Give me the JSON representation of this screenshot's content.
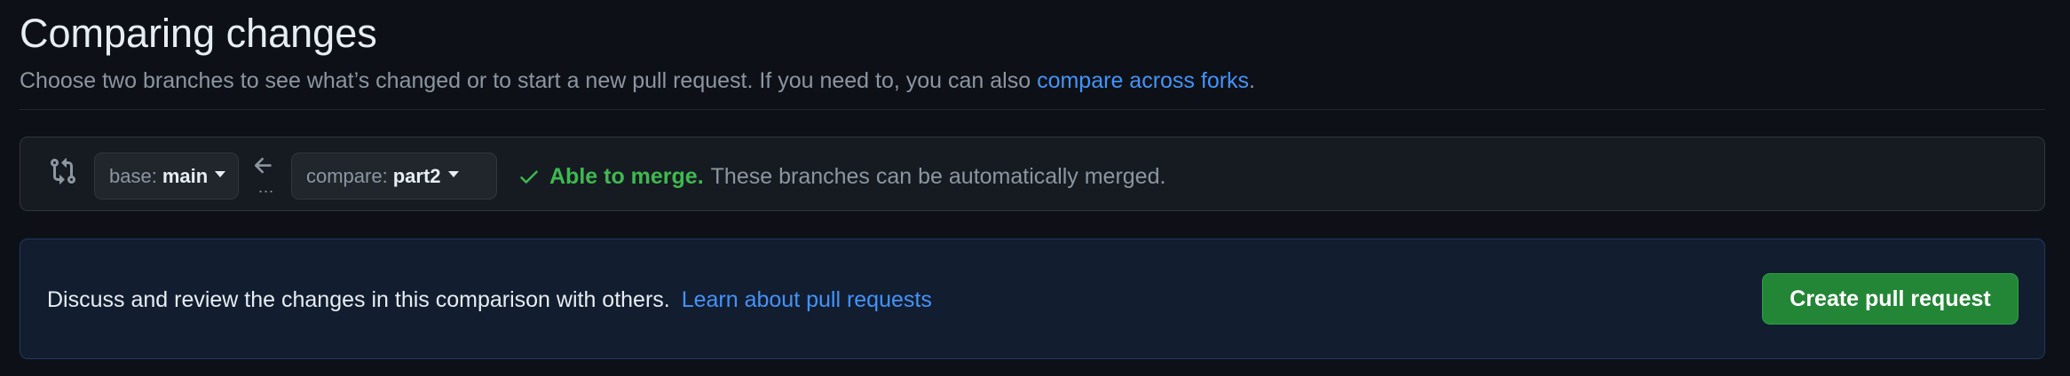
{
  "header": {
    "title": "Comparing changes",
    "subtitle_text": "Choose two branches to see what’s changed or to start a new pull request. If you need to, you can also",
    "subtitle_link": "compare across forks",
    "subtitle_end": "."
  },
  "range": {
    "base_prefix": "base:",
    "base_branch": "main",
    "compare_prefix": "compare:",
    "compare_branch": "part2",
    "dots": "...",
    "merge_status": "Able to merge.",
    "merge_description": "These branches can be automatically merged."
  },
  "discuss": {
    "text": "Discuss and review the changes in this comparison with others.",
    "link": "Learn about pull requests",
    "button": "Create pull request"
  },
  "colors": {
    "background": "#0d1117",
    "link": "#4493f8",
    "success": "#3fb950",
    "primary_button": "#238636"
  },
  "icons": [
    "git-compare-icon",
    "arrow-left-icon",
    "check-icon",
    "caret-down-icon"
  ]
}
